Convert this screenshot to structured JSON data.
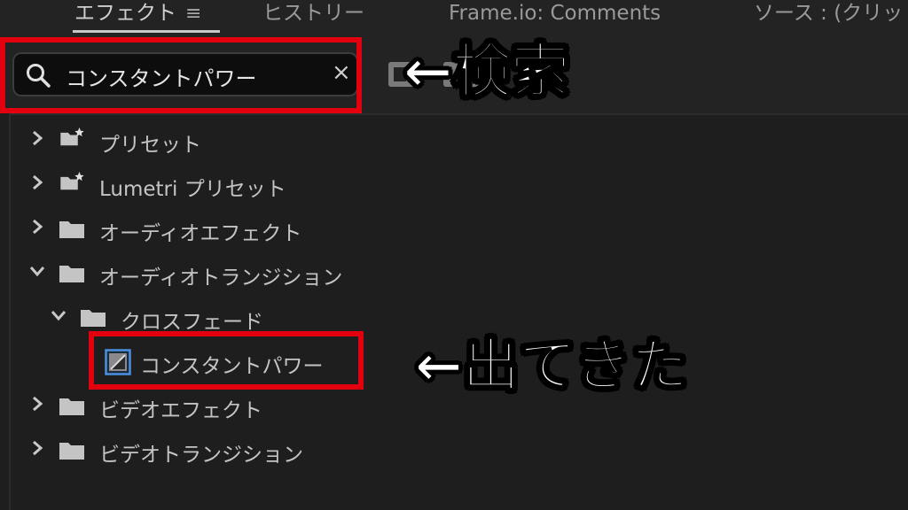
{
  "tabs": [
    {
      "label": "エフェクト",
      "active": true
    },
    {
      "label": "ヒストリー",
      "active": false
    },
    {
      "label": "Frame.io: Comments",
      "active": false
    },
    {
      "label": "ソース : (クリッ",
      "active": false
    }
  ],
  "tab_menu_icon": "hamburger-menu-icon",
  "search": {
    "value": "コンスタントパワー",
    "clear_icon": "close-icon"
  },
  "annotations": {
    "search_label": "←検索",
    "found_label": "←出てきた",
    "highlight_color": "#e3000e"
  },
  "tree": [
    {
      "label": "プリセット",
      "expanded": false,
      "icon": "preset-folder-icon"
    },
    {
      "label": "Lumetri プリセット",
      "expanded": false,
      "icon": "preset-folder-icon"
    },
    {
      "label": "オーディオエフェクト",
      "expanded": false,
      "icon": "folder-icon"
    },
    {
      "label": "オーディオトランジション",
      "expanded": true,
      "icon": "folder-icon"
    },
    {
      "label": "クロスフェード",
      "expanded": true,
      "icon": "folder-icon"
    },
    {
      "label": "コンスタントパワー",
      "icon": "audio-transition-icon"
    },
    {
      "label": "ビデオエフェクト",
      "expanded": false,
      "icon": "folder-icon"
    },
    {
      "label": "ビデオトランジション",
      "expanded": false,
      "icon": "folder-icon"
    }
  ]
}
